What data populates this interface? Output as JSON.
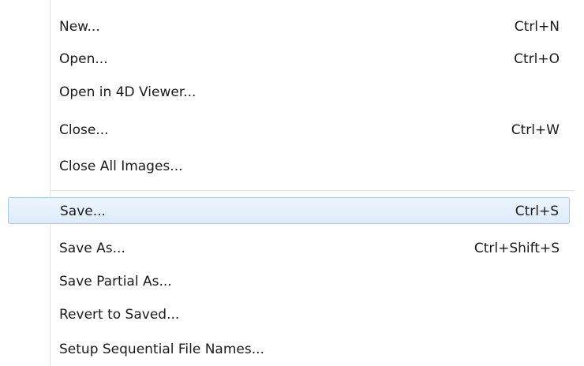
{
  "menu": {
    "items": [
      {
        "label": "New...",
        "shortcut": "Ctrl+N"
      },
      {
        "label": "Open...",
        "shortcut": "Ctrl+O"
      },
      {
        "label": "Open in 4D Viewer...",
        "shortcut": ""
      },
      {
        "label": "Close...",
        "shortcut": "Ctrl+W"
      },
      {
        "label": "Close All Images...",
        "shortcut": ""
      },
      {
        "label": "Save...",
        "shortcut": "Ctrl+S",
        "highlighted": true
      },
      {
        "label": "Save As...",
        "shortcut": "Ctrl+Shift+S"
      },
      {
        "label": "Save Partial As...",
        "shortcut": ""
      },
      {
        "label": "Revert to Saved...",
        "shortcut": ""
      },
      {
        "label": "Setup Sequential File Names...",
        "shortcut": ""
      }
    ]
  },
  "colors": {
    "highlight_border": "#a8c8ec",
    "highlight_fill": "#dcebfb",
    "separator": "#e2e3e3"
  }
}
